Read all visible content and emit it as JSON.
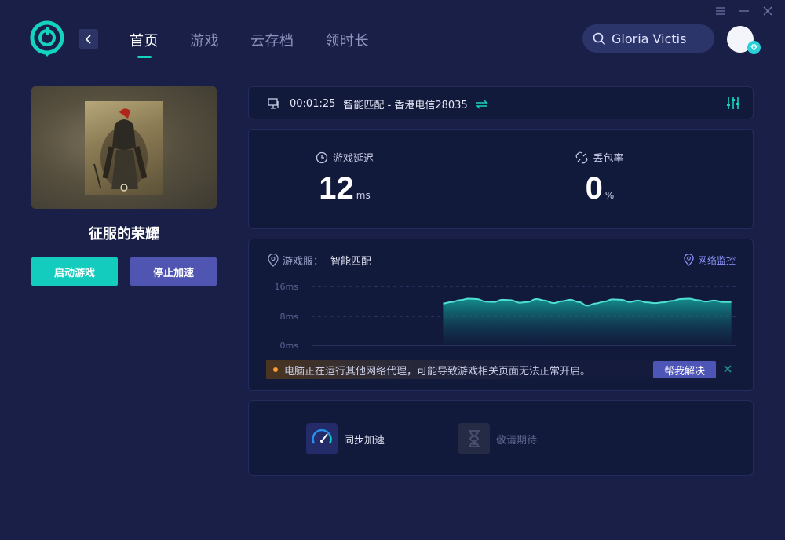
{
  "window": {
    "controls": [
      "menu-icon",
      "minimize-icon",
      "close-icon"
    ]
  },
  "nav": {
    "items": [
      {
        "label": "首页",
        "active": true
      },
      {
        "label": "游戏",
        "active": false
      },
      {
        "label": "云存档",
        "active": false
      },
      {
        "label": "领时长",
        "active": false
      }
    ]
  },
  "search": {
    "value": "Gloria Victis"
  },
  "game": {
    "title": "征服的荣耀"
  },
  "buttons": {
    "start": "启动游戏",
    "stop": "停止加速"
  },
  "status": {
    "time": "00:01:25",
    "mode": "智能匹配 - 香港电信28035"
  },
  "metrics": {
    "latency": {
      "label": "游戏延迟",
      "value": "12",
      "unit": "ms"
    },
    "loss": {
      "label": "丢包率",
      "value": "0",
      "unit": "%"
    }
  },
  "server": {
    "label": "游戏服：",
    "value": "智能匹配",
    "monitor": "网络监控"
  },
  "chart_data": {
    "type": "area",
    "y_ticks": [
      "16ms",
      "8ms",
      "0ms"
    ],
    "ylim": [
      0,
      16
    ],
    "xlim": [
      0,
      100
    ],
    "grid": true,
    "series": [
      {
        "x": [
          31,
          33,
          35,
          37,
          39,
          41,
          43,
          45,
          47,
          49,
          51,
          53,
          55,
          57,
          59,
          61,
          63,
          65,
          67,
          69,
          71,
          73,
          75,
          77,
          79,
          81,
          83,
          85,
          87,
          89,
          91,
          93,
          95,
          97,
          99
        ],
        "values": [
          11.4,
          11.8,
          12.3,
          12.7,
          12.6,
          11.9,
          11.8,
          12.4,
          12.3,
          11.6,
          11.8,
          12.6,
          12.2,
          11.5,
          12.0,
          12.4,
          11.8,
          10.8,
          11.4,
          11.9,
          12.5,
          12.4,
          11.8,
          12.2,
          11.7,
          11.5,
          11.7,
          12.1,
          12.6,
          12.7,
          12.3,
          11.9,
          12.2,
          11.8,
          11.8
        ]
      }
    ]
  },
  "warning": {
    "text": "电脑正在运行其他网络代理，可能导致游戏相关页面无法正常开启。",
    "action": "帮我解决"
  },
  "features": [
    {
      "label": "同步加速",
      "icon": "speedometer-icon",
      "enabled": true
    },
    {
      "label": "敬请期待",
      "icon": "hourglass-icon",
      "enabled": false
    }
  ],
  "colors": {
    "accent": "#14d3c0",
    "background": "#1a1f47",
    "card": "#121a3c",
    "stop_button": "#4f55b0",
    "warning": "#ff9b2f"
  }
}
